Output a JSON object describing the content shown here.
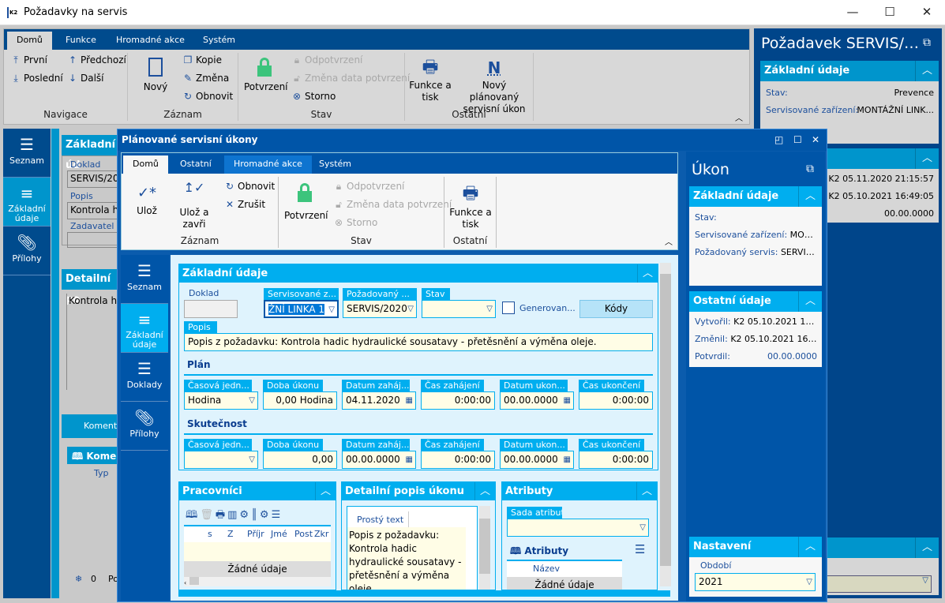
{
  "window": {
    "title": "Požadavky na servis",
    "minimize": "—",
    "maximize": "☐",
    "close": "✕"
  },
  "ribbon1": {
    "tabs": [
      "Domů",
      "Funkce",
      "Hromadné akce",
      "Systém"
    ],
    "navigace": {
      "prvni": "První",
      "posledni": "Poslední",
      "predchozi": "Předchozí",
      "dalsi": "Další",
      "group": "Navigace"
    },
    "zaznam": {
      "novy": "Nový",
      "kopie": "Kopie",
      "zmena": "Změna",
      "obnovit": "Obnovit",
      "group": "Záznam"
    },
    "stav": {
      "potvrzeni": "Potvrzení",
      "odpotvrzeni": "Odpotvrzení",
      "zmena_data": "Změna data potvrzení",
      "storno": "Storno",
      "group": "Stav"
    },
    "ostatni": {
      "funkce_tisk": "Funkce a tisk",
      "novy_ukon": "Nový plánovaný servisní úkon",
      "group": "Ostatní"
    }
  },
  "left_nav": [
    {
      "label": "Seznam"
    },
    {
      "label": "Základní údaje"
    },
    {
      "label": "Přílohy"
    }
  ],
  "background_form": {
    "section": "Základní úd",
    "doklad_label": "Doklad",
    "doklad": "SERVIS/20",
    "popis_label": "Popis",
    "popis": "Kontrola h",
    "zadavatel_label": "Zadavatel",
    "detail_section": "Detailní po",
    "detail_text": "Kontrola h",
    "komentare": "Komenta",
    "komentare_grid": "Kome",
    "col_typ": "Typ",
    "count": "0",
    "po": "Po"
  },
  "right_panel": {
    "title": "Požadavek SERVIS/2...",
    "zakladni": "Základní údaje",
    "stav_label": "Stav:",
    "stav": "Prevence",
    "zarizeni_label": "Servisované zařízení:",
    "zarizeni": "MONTÁŽNÍ LINK...",
    "vytvoril": "K2 05.11.2020 21:15:57",
    "zmenil": "K2 05.10.2021 16:49:05",
    "potvrdil": "00.00.0000"
  },
  "modal": {
    "title": "Plánované servisní úkony",
    "tabs": [
      "Domů",
      "Ostatní",
      "Hromadné akce",
      "Systém"
    ],
    "zaznam": {
      "uloz": "Ulož",
      "uloz_zavri": "Ulož a zavři",
      "obnovit": "Obnovit",
      "zrusit": "Zrušit",
      "group": "Záznam"
    },
    "stav": {
      "potvrzeni": "Potvrzení",
      "odpotvrzeni": "Odpotvrzení",
      "zmena_data": "Změna data potvrzení",
      "storno": "Storno",
      "group": "Stav"
    },
    "ostatni": {
      "funkce_tisk": "Funkce a tisk",
      "group": "Ostatní"
    },
    "nav": [
      {
        "label": "Seznam"
      },
      {
        "label": "Základní údaje"
      },
      {
        "label": "Doklady"
      },
      {
        "label": "Přílohy"
      }
    ],
    "zakladni": {
      "title": "Základní údaje",
      "doklad_label": "Doklad",
      "doklad": "",
      "zarizeni_label": "Servisované z...",
      "zarizeni": "ŽNÍ LINKA 1",
      "pozadovany_label": "Požadovaný ...",
      "pozadovany": "SERVIS/2020",
      "stav_label": "Stav",
      "stav": "",
      "generovano_label": "Generovan...",
      "generovano": false,
      "kody": "Kódy",
      "popis_label": "Popis",
      "popis": "Popis z požadavku: Kontrola hadic hydraulické sousatavy - přetěsnění a výměna oleje.",
      "plan_title": "Plán",
      "skutecnost_title": "Skutečnost",
      "col_labels": [
        "Časová jedn...",
        "Doba úkonu",
        "Datum zaháj...",
        "Čas zahájení",
        "Datum ukon...",
        "Čas ukončení"
      ],
      "plan": [
        "Hodina",
        "0,00 Hodina",
        "04.11.2020",
        "0:00:00",
        "00.00.0000",
        "0:00:00"
      ],
      "skutecnost": [
        "",
        "0,00",
        "00.00.0000",
        "0:00:00",
        "00.00.0000",
        "0:00:00"
      ]
    },
    "pracovnici": {
      "title": "Pracovníci",
      "columns": [
        "s",
        "Z",
        "Příjr",
        "Jmé",
        "Post",
        "Zkr"
      ],
      "empty": "Žádné údaje"
    },
    "detail": {
      "title": "Detailní popis úkonu",
      "mode": "Prostý text",
      "text": "Popis z požadavku: Kontrola hadic hydraulické sousatavy - přetěsnění a výměna oleje."
    },
    "atributy": {
      "title": "Atributy",
      "sada_label": "Sada atributů",
      "sada": "",
      "grid_title": "Atributy",
      "col_nazev": "Název",
      "empty": "Žádné údaje"
    },
    "ukon": {
      "title": "Úkon",
      "zakladni": "Základní údaje",
      "stav_label": "Stav:",
      "stav": "",
      "zarizeni_label": "Servisované zařízení:",
      "zarizeni": "MONT...",
      "pozadovany_label": "Požadovaný servis:",
      "pozadovany": "SERVIS/...",
      "ostatni": "Ostatní údaje",
      "vytvoril_label": "Vytvořil:",
      "vytvoril": "K2 05.10.2021 16:4...",
      "zmenil_label": "Změnil:",
      "zmenil": "K2 05.10.2021 16:49...",
      "potvrdil_label": "Potvrdil:",
      "potvrdil": "00.00.0000",
      "nastaveni": "Nastavení",
      "obdobi_label": "Období",
      "obdobi": "2021"
    }
  },
  "colors": {
    "dark_blue": "#004b8d",
    "modal_blue": "#0055a8",
    "accent": "#00aeef",
    "input_bg": "#fffde6",
    "confirm_green": "#3cc47c"
  }
}
